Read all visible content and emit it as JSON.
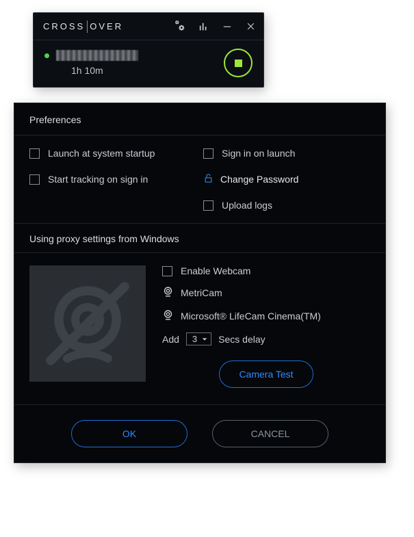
{
  "brand": {
    "left": "CROSS",
    "right": "OVER"
  },
  "widget": {
    "duration": "1h 10m"
  },
  "preferences": {
    "title": "Preferences",
    "launch_startup": "Launch at system startup",
    "sign_in_launch": "Sign in on launch",
    "start_tracking": "Start tracking on sign in",
    "change_password": "Change Password",
    "upload_logs": "Upload logs"
  },
  "proxy": {
    "heading": "Using proxy settings from Windows"
  },
  "webcam": {
    "enable": "Enable Webcam",
    "cam1": "MetriCam",
    "cam2": "Microsoft® LifeCam Cinema(TM)",
    "add_label": "Add",
    "delay_value": "3",
    "delay_suffix": "Secs delay",
    "test": "Camera Test"
  },
  "footer": {
    "ok": "OK",
    "cancel": "CANCEL"
  }
}
